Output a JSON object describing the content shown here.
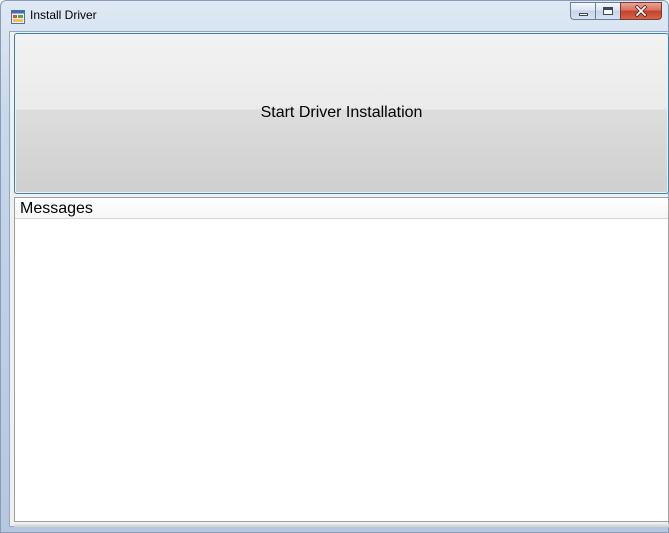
{
  "window": {
    "title": "Install Driver",
    "app_icon": "application-window-icon",
    "caption_buttons": [
      "minimize-icon",
      "maximize-icon",
      "close-icon"
    ]
  },
  "main": {
    "start_button_label": "Start Driver Installation",
    "messages_header": "Messages",
    "messages": []
  },
  "colors": {
    "button_border": "#3c7fb1",
    "close_button": "#c5402a",
    "titlebar": "#c9d9ec"
  }
}
